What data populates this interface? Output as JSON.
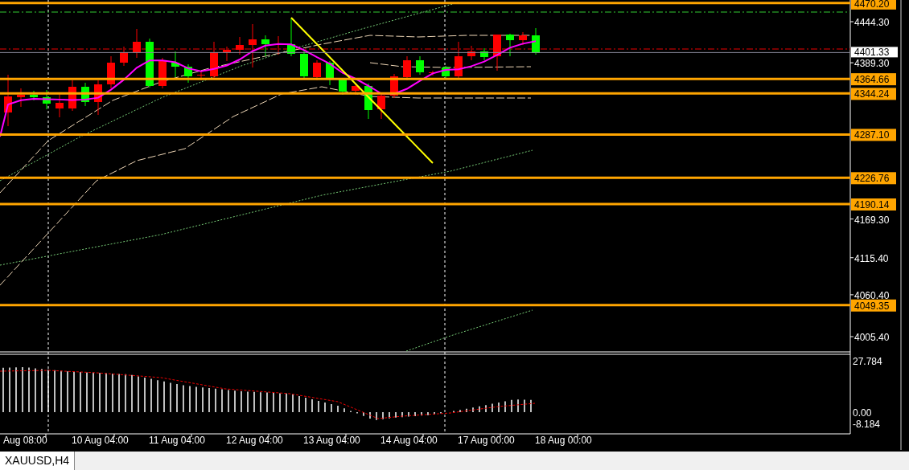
{
  "chart": {
    "price_axis": [
      "4444.30",
      "4389.30",
      "4169.30",
      "4115.40",
      "4060.40",
      "4005.40"
    ],
    "price_levels": [
      {
        "price": "4470.20",
        "kind": "level"
      },
      {
        "price": "4401.33",
        "kind": "current"
      },
      {
        "price": "4364.66",
        "kind": "level"
      },
      {
        "price": "4344.24",
        "kind": "level"
      },
      {
        "price": "4287.10",
        "kind": "level"
      },
      {
        "price": "4226.76",
        "kind": "level"
      },
      {
        "price": "4190.14",
        "kind": "level"
      },
      {
        "price": "4049.35",
        "kind": "level"
      }
    ],
    "indicator_axis": [
      "27.784",
      "0.00",
      "-8.184"
    ],
    "time_axis": [
      "Aug 08:00",
      "10 Aug 04:00",
      "11 Aug 04:00",
      "12 Aug 04:00",
      "13 Aug 04:00",
      "14 Aug 04:00",
      "17 Aug 00:00",
      "18 Aug 00:00"
    ]
  },
  "tabs": [
    {
      "label": "XAUUSD,H4",
      "selected": true
    }
  ]
}
